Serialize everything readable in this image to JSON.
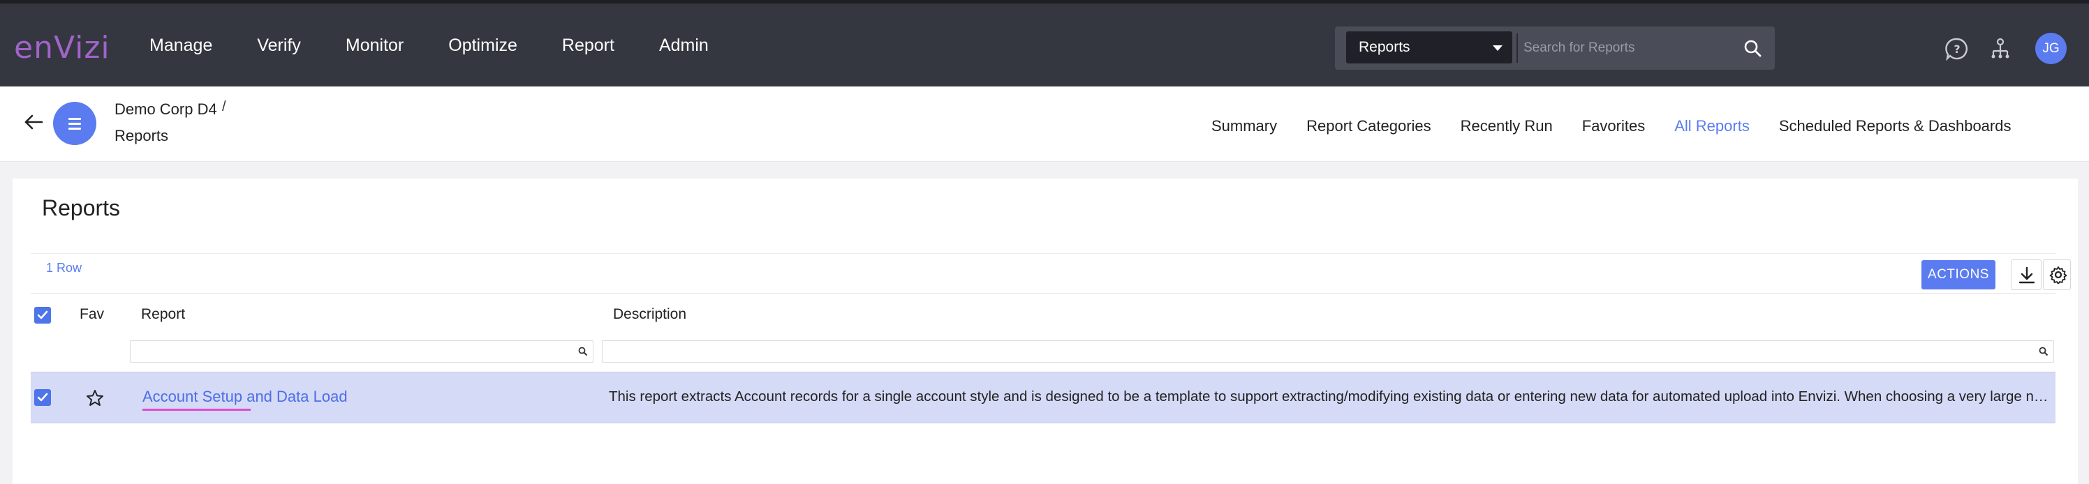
{
  "brand": {
    "logo_text": "enVizi",
    "logo_color": "#a064c8"
  },
  "nav": {
    "items": [
      "Manage",
      "Verify",
      "Monitor",
      "Optimize",
      "Report",
      "Admin"
    ]
  },
  "search": {
    "scope": "Reports",
    "placeholder": "Search for Reports"
  },
  "user": {
    "initials": "JG"
  },
  "breadcrumb": {
    "org": "Demo Corp D4",
    "separator": "/",
    "page": "Reports"
  },
  "tabs": [
    {
      "label": "Summary",
      "active": false
    },
    {
      "label": "Report Categories",
      "active": false
    },
    {
      "label": "Recently Run",
      "active": false
    },
    {
      "label": "Favorites",
      "active": false
    },
    {
      "label": "All Reports",
      "active": true
    },
    {
      "label": "Scheduled Reports & Dashboards",
      "active": false
    }
  ],
  "main": {
    "title": "Reports",
    "row_count": "1 Row",
    "actions_label": "ACTIONS",
    "columns": {
      "fav": "Fav",
      "report": "Report",
      "description": "Description"
    },
    "rows": [
      {
        "selected": true,
        "favorite": false,
        "report": "Account Setup and Data Load",
        "description": "This report extracts Account records for a single account style and is designed to be a template to support extracting/modifying existing data or entering new data for automated upload into Envizi. When choosing a very large number of accounts or selecting multiple account styles the report may take a long time to generate."
      }
    ]
  },
  "colors": {
    "topbar": "#343640",
    "accent": "#5b7cf0",
    "selected_row": "#d5daf7"
  }
}
